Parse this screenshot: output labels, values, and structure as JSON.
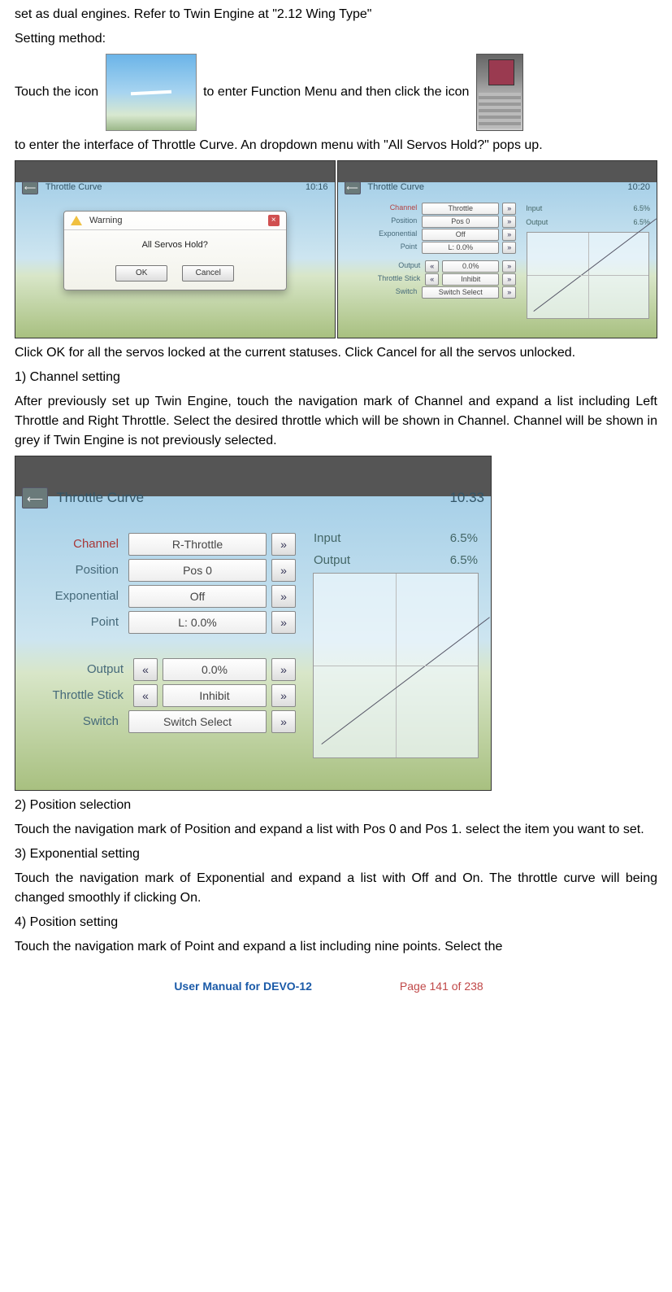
{
  "intro": {
    "line1": "set as dual engines. Refer to Twin Engine at \"2.12 Wing Type\"",
    "setting_method": "Setting method:",
    "before_icon1": "Touch the icon",
    "between_icons": "to enter Function Menu and then click the icon",
    "after_icon2": "to enter the interface of Throttle Curve. An dropdown menu with \"All Servos Hold?\" pops up."
  },
  "screenshot1": {
    "title": "Throttle Curve",
    "time": "10:16",
    "warning_label": "Warning",
    "warning_msg": "All Servos Hold?",
    "ok": "OK",
    "cancel": "Cancel"
  },
  "screenshot2": {
    "title": "Throttle Curve",
    "time": "10:20",
    "rows": {
      "channel_label": "Channel",
      "channel_value": "Throttle",
      "position_label": "Position",
      "position_value": "Pos 0",
      "exponential_label": "Exponential",
      "exponential_value": "Off",
      "point_label": "Point",
      "point_value": "L: 0.0%",
      "output_label": "Output",
      "output_value": "0.0%",
      "throttle_stick_label": "Throttle Stick",
      "throttle_stick_value": "Inhibit",
      "switch_label": "Switch",
      "switch_value": "Switch Select"
    },
    "io": {
      "input_label": "Input",
      "input_value": "6.5%",
      "output_label": "Output",
      "output_value": "6.5%"
    }
  },
  "para_after_pair": "Click OK for all the servos locked at the current statuses. Click Cancel for all the servos unlocked.",
  "section1": {
    "heading": "1)  Channel setting",
    "body": "After previously set up Twin Engine, touch the navigation mark of Channel and expand a list including Left Throttle and Right Throttle. Select the desired throttle which will be shown in Channel. Channel will be shown in grey if Twin Engine is not previously selected."
  },
  "screenshot3": {
    "title": "Throttle Curve",
    "time": "10:33",
    "rows": {
      "channel_label": "Channel",
      "channel_value": "R-Throttle",
      "position_label": "Position",
      "position_value": "Pos 0",
      "exponential_label": "Exponential",
      "exponential_value": "Off",
      "point_label": "Point",
      "point_value": "L: 0.0%",
      "output_label": "Output",
      "output_value": "0.0%",
      "throttle_stick_label": "Throttle Stick",
      "throttle_stick_value": "Inhibit",
      "switch_label": "Switch",
      "switch_value": "Switch Select"
    },
    "io": {
      "input_label": "Input",
      "input_value": "6.5%",
      "output_label": "Output",
      "output_value": "6.5%"
    }
  },
  "section2": {
    "heading": "2)  Position selection",
    "body": "Touch the navigation mark of Position and expand a list with Pos 0 and Pos 1. select the item you want to set."
  },
  "section3": {
    "heading": "3)  Exponential setting",
    "body": "Touch the navigation mark of Exponential and expand a list with Off and On. The throttle curve will being changed smoothly if clicking On."
  },
  "section4": {
    "heading": "4)  Position setting",
    "body": "Touch the navigation mark of Point and expand a list including nine points. Select the"
  },
  "footer": {
    "name": "User Manual for DEVO-12",
    "page": "Page 141 of 238"
  },
  "glyphs": {
    "left_arrow": "«",
    "right_arrow": "»",
    "back": "⟵",
    "close": "×"
  }
}
